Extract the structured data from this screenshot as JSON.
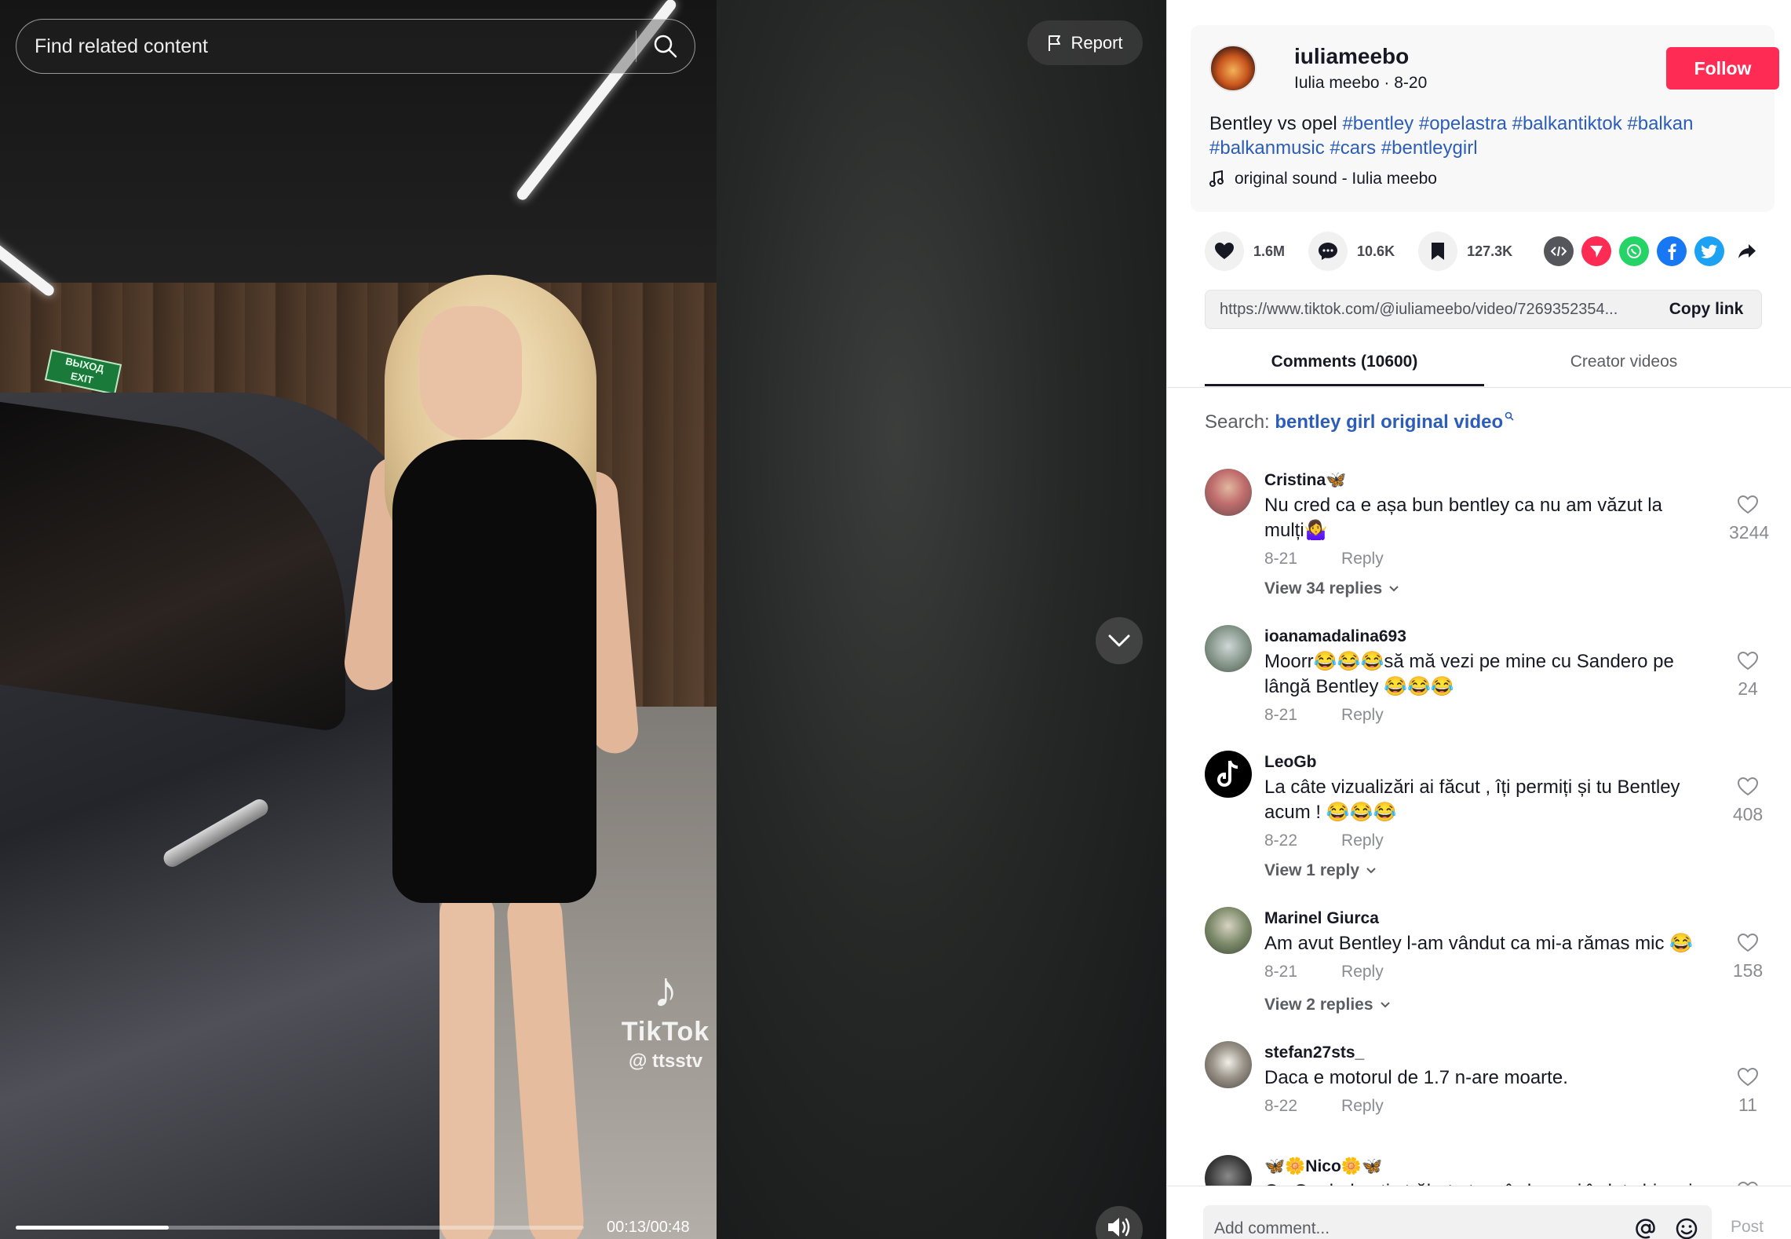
{
  "video": {
    "search_placeholder": "Find related content",
    "report_label": "Report",
    "time": "00:13/00:48",
    "progress": 0.27,
    "watermark_brand": "TikTok",
    "watermark_handle": "@ ttsstv",
    "exit_sign": "ВЫХОД\nEXIT"
  },
  "author": {
    "username": "iuliameebo",
    "meta": "Iulia meebo · 8-20",
    "follow_label": "Follow",
    "caption_text": "Bentley vs opel ",
    "hashtags": [
      "#bentley",
      "#opelastra",
      "#balkantiktok",
      "#balkan",
      "#balkanmusic",
      "#cars",
      "#bentleygirl"
    ],
    "sound": "original sound - Iulia meebo"
  },
  "stats": {
    "likes": "1.6M",
    "comments": "10.6K",
    "saves": "127.3K"
  },
  "share_icons": [
    "embed-icon",
    "send-icon",
    "whatsapp-icon",
    "facebook-icon",
    "twitter-icon",
    "share-arrow-icon"
  ],
  "colors": {
    "accent": "#fe2c55",
    "link": "#2b5db9"
  },
  "link": {
    "url": "https://www.tiktok.com/@iuliameebo/video/7269352354...",
    "copy_label": "Copy link"
  },
  "tabs": {
    "comments": "Comments (10600)",
    "creator": "Creator videos"
  },
  "related_search": {
    "label": "Search: ",
    "term": "bentley girl original video"
  },
  "comments": [
    {
      "username": "Cristina🦋",
      "text": "Nu cred ca e așa bun bentley ca nu am văzut la mulți🤷‍♀️",
      "date": "8-21",
      "reply": "Reply",
      "likes": "3244",
      "view_replies": "View 34 replies"
    },
    {
      "username": "ioanamadalina693",
      "text": "Moorr😂😂😂să mă vezi pe mine cu Sandero pe lângă Bentley 😂😂😂",
      "date": "8-21",
      "reply": "Reply",
      "likes": "24",
      "view_replies": ""
    },
    {
      "username": "LeoGb",
      "text": "La câte vizualizări ai făcut , îți permiți și tu Bentley acum ! 😂😂😂",
      "date": "8-22",
      "reply": "Reply",
      "likes": "408",
      "view_replies": "View 1 reply"
    },
    {
      "username": "Marinel Giurca",
      "text": "Am avut Bentley l-am vândut ca mi-a rămas mic 😂",
      "date": "8-21",
      "reply": "Reply",
      "likes": "158",
      "view_replies": "View 2 replies"
    },
    {
      "username": "stefan27sts_",
      "text": "Daca e motorul de 1.7 n-are moarte.",
      "date": "8-22",
      "reply": "Reply",
      "likes": "11",
      "view_replies": ""
    },
    {
      "username": "🦋🌼Nico🌼🦋",
      "text": "Cu Opel-ul poti străbate tara în lung si în lat chiar si",
      "date": "",
      "reply": "",
      "likes": "",
      "view_replies": ""
    }
  ],
  "comment_bar": {
    "placeholder": "Add comment...",
    "post_label": "Post"
  }
}
